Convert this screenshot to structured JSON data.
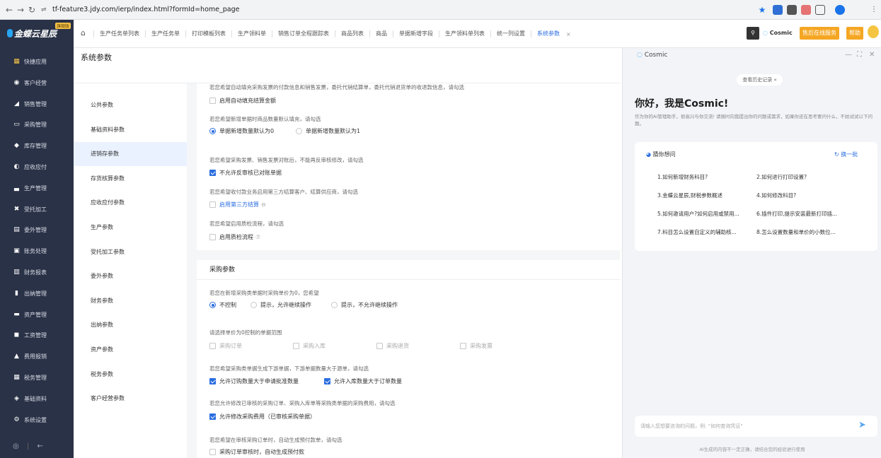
{
  "browser": {
    "url": "tf-feature3.jdy.com/ierp/index.html?formId=home_page",
    "colors": {
      "star": "#1a73e8"
    }
  },
  "app": {
    "logo_text": "金蝶云星辰",
    "logo_badge": "旗舰版",
    "tabs": [
      "生产任务单列表",
      "生产任务单",
      "打印模板列表",
      "生产领料单",
      "销售订单全程跟踪表",
      "商品列表",
      "商品",
      "单据新增字段",
      "生产领料单列表",
      "统一列设置",
      "系统参数"
    ],
    "active_tab": "系统参数",
    "cosmic_label": "Cosmic",
    "service_label": "售后在线服务",
    "help_label": "帮助"
  },
  "sidebar": {
    "items": [
      {
        "label": "快捷应用",
        "icon": "grid-icon"
      },
      {
        "label": "客户经营",
        "icon": "person-icon"
      },
      {
        "label": "销售管理",
        "icon": "chart-icon"
      },
      {
        "label": "采购管理",
        "icon": "cart-icon"
      },
      {
        "label": "库存管理",
        "icon": "box-icon"
      },
      {
        "label": "应收应付",
        "icon": "coin-icon"
      },
      {
        "label": "生产管理",
        "icon": "factory-icon"
      },
      {
        "label": "受托加工",
        "icon": "tool-icon"
      },
      {
        "label": "委外管理",
        "icon": "outsource-icon"
      },
      {
        "label": "账务处理",
        "icon": "ledger-icon"
      },
      {
        "label": "财务报表",
        "icon": "report-icon"
      },
      {
        "label": "出纳管理",
        "icon": "cashier-icon"
      },
      {
        "label": "资产管理",
        "icon": "asset-icon"
      },
      {
        "label": "工资管理",
        "icon": "salary-icon"
      },
      {
        "label": "费用报销",
        "icon": "expense-icon"
      },
      {
        "label": "税务管理",
        "icon": "tax-icon"
      },
      {
        "label": "基础资料",
        "icon": "layers-icon"
      },
      {
        "label": "系统设置",
        "icon": "settings-icon"
      }
    ]
  },
  "page": {
    "title": "系统参数"
  },
  "leftnav": {
    "items": [
      "公共参数",
      "基础资料参数",
      "进销存参数",
      "存货核算参数",
      "应收应付参数",
      "生产参数",
      "受托加工参数",
      "委外参数",
      "财务参数",
      "出纳参数",
      "资产参数",
      "税务参数",
      "客户经营参数"
    ],
    "active_index": 2
  },
  "content": {
    "truncated_question": "若您希望自动填充采购发票的付款信息和销售发票，委托代销结算单，委托代销退货单的收退款信息，请勾选",
    "auto_fill_label": "启用自动填充结算金额",
    "q_qty": "若您希望新增单据时商品数量默认填充，请勾选",
    "opt_qty0": "单据新增数量默认为0",
    "opt_qty1": "单据新增数量默认为1",
    "q_invoice": "若您希望采购发票、销售发票对账后，不能再反审核修改，请勾选",
    "opt_invoice": "不允许反审核已对账单据",
    "q_third": "若您希望收付款业务启用第三方结算客户、结算供应商，请勾选",
    "opt_third": "启用第三方结算",
    "q_qc": "若您希望启用质检流程，请勾选",
    "opt_qc": "启用质检流程",
    "section_purchase": "采购参数",
    "q_price0": "若您在新增采购类单据时采购单价为0，您希望",
    "opt_noctrl": "不控制",
    "opt_warn_allow": "提示，允许继续操作",
    "opt_warn_deny": "提示，不允许继续操作",
    "q_scope": "请选择单价为0控制的单据范围",
    "scope": [
      "采购订单",
      "采购入库",
      "采购退货",
      "采购发票"
    ],
    "q_downstream": "若您希望采购类单据生成下游单据，下游单据数量大于源单，请勾选",
    "opt_order_gt": "允许订购数量大于申请批准数量",
    "opt_in_gt": "允许入库数量大于订单数量",
    "q_fee": "若您允许修改已审核的采购订单、采购入库单等采购类单据的采购费用，请勾选",
    "opt_fee": "允许修改采购费用（已审核采购单据）",
    "q_prepay": "若您希望在审核采购订单时，自动生成预付款单，请勾选",
    "opt_prepay": "采购订单审核时，自动生成预付款"
  },
  "cosmic": {
    "title": "Cosmic",
    "history": "查看历史记录",
    "hello": "你好，我是Cosmic!",
    "intro": "作为你的AI管理助手，很高兴与你交流! 请随时向我提出你的问题或需求，如果你还在思考要问什么，不妨试试以下问题。",
    "guess_title": "猜你想问",
    "refresh": "换一批",
    "questions": [
      "1.如何新增财务科目?",
      "2.如何进行打印设置?",
      "3.金蝶云星辰,财税参数概述",
      "4.如何修改科目?",
      "5.如何邀请用户?如何启用或禁用...",
      "6.插件打印,提示安装最新打印插...",
      "7.科目怎么设置自定义的辅助核...",
      "8.怎么设置数量和单价的小数位..."
    ],
    "input_placeholder": "请输入您想要咨询的问题，例: “如何查询凭证”",
    "disclaimer": "AI生成的内容不一定正确，请结合您的经验进行使用"
  }
}
